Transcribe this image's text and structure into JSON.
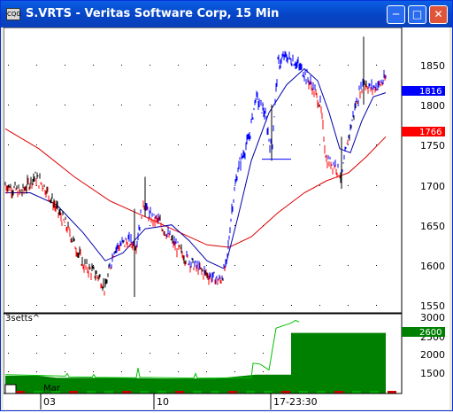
{
  "window": {
    "title": "S.VRTS - Veritas Software Corp, 15 Min",
    "icon_label": "CQG",
    "minimize_icon": "minimize-icon",
    "maximize_icon": "maximize-icon",
    "close_icon": "close-icon"
  },
  "colors": {
    "up": "#0000ff",
    "down": "#ff0000",
    "neutral": "#000000",
    "ma_fast": "#0000aa",
    "ma_slow": "#dd0000",
    "volume_fill": "#008000",
    "volume_line": "#00c000"
  },
  "price_panel": {
    "y_ticks": [
      "1850",
      "1800",
      "1750",
      "1700",
      "1650",
      "1600",
      "1550"
    ],
    "last_price_blue": "1816",
    "last_price_red": "1766"
  },
  "volume_panel": {
    "label": "3setts^",
    "y_ticks": [
      "3000",
      "2500",
      "2000",
      "1500"
    ],
    "last_value": "2600"
  },
  "x_axis": {
    "month": "Mar",
    "labels": [
      "03",
      "10",
      "17-23:30"
    ]
  }
}
